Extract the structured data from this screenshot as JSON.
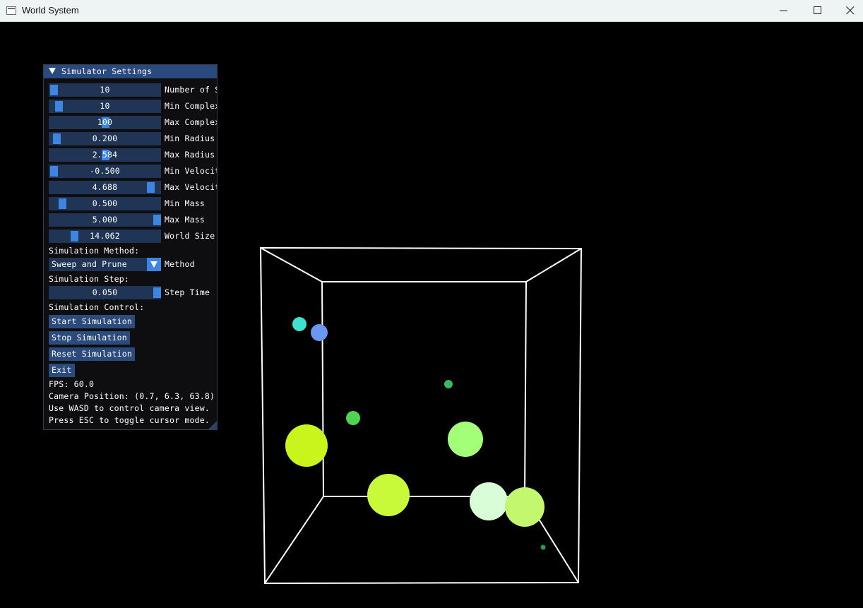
{
  "window": {
    "title": "World System",
    "controls": {
      "minimize_icon": "minimize-icon",
      "maximize_icon": "maximize-icon",
      "close_icon": "close-icon"
    }
  },
  "panel": {
    "title": "Simulator Settings",
    "sliders": [
      {
        "value": "10",
        "label": "Number of S",
        "fraction": 0.0
      },
      {
        "value": "10",
        "label": "Min Complex",
        "fraction": 0.05
      },
      {
        "value": "100",
        "label": "Max Complex",
        "fraction": 0.5
      },
      {
        "value": "0.200",
        "label": "Min Radius",
        "fraction": 0.03
      },
      {
        "value": "2.584",
        "label": "Max Radius",
        "fraction": 0.5
      },
      {
        "value": "-0.500",
        "label": "Min Velocit",
        "fraction": 0.0
      },
      {
        "value": "4.688",
        "label": "Max Velocit",
        "fraction": 0.94
      },
      {
        "value": "0.500",
        "label": "Min Mass",
        "fraction": 0.08
      },
      {
        "value": "5.000",
        "label": "Max Mass",
        "fraction": 1.0
      },
      {
        "value": "14.062",
        "label": "World Size",
        "fraction": 0.2
      }
    ],
    "method_heading": "Simulation Method:",
    "method_combo": {
      "value": "Sweep and Prune",
      "label": "Method"
    },
    "step_heading": "Simulation Step:",
    "step_slider": {
      "value": "0.050",
      "label": "Step Time",
      "fraction": 1.0
    },
    "control_heading": "Simulation Control:",
    "buttons": {
      "start": "Start Simulation",
      "stop": "Stop Simulation",
      "reset": "Reset Simulation",
      "exit": "Exit"
    },
    "status": {
      "fps": "FPS: 60.0",
      "camera": "Camera Position: (0.7, 6.3, 63.8)",
      "hint_wasd": "Use WASD to control camera view.",
      "hint_esc": "Press ESC to toggle cursor mode."
    }
  },
  "scene": {
    "box_color": "#ffffff",
    "spheres": [
      {
        "color": "#40e0d0"
      },
      {
        "color": "#6b96f2"
      },
      {
        "color": "#3ab865"
      },
      {
        "color": "#4fd452"
      },
      {
        "color": "#c7f51c"
      },
      {
        "color": "#a2ff77"
      },
      {
        "color": "#c8fa39"
      },
      {
        "color": "#d9fdd6"
      },
      {
        "color": "#c3f76d"
      },
      {
        "color": "#2a9a4e"
      }
    ]
  }
}
